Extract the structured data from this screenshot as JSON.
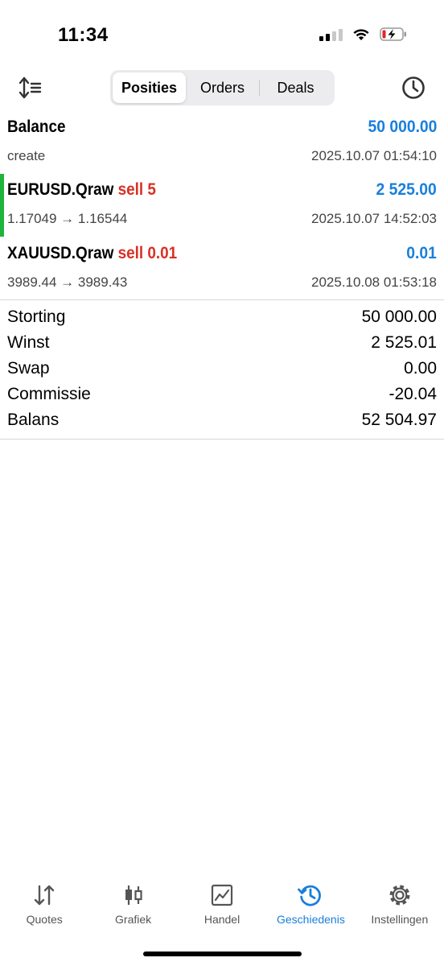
{
  "status_bar": {
    "time": "11:34"
  },
  "toolbar": {
    "segments": [
      "Posities",
      "Orders",
      "Deals"
    ],
    "active_segment": "Posities"
  },
  "deals": [
    {
      "symbol": "Balance",
      "side": "",
      "amount": "50 000.00",
      "detail": "create",
      "time": "2025.10.07 01:54:10"
    },
    {
      "symbol": "EURUSD.Qraw",
      "side": "sell 5",
      "amount": "2 525.00",
      "detail": "1.17049 → 1.16544",
      "time": "2025.10.07 14:52:03"
    },
    {
      "symbol": "XAUUSD.Qraw",
      "side": "sell 0.01",
      "amount": "0.01",
      "detail": "3989.44 → 3989.43",
      "time": "2025.10.08 01:53:18"
    }
  ],
  "summary": [
    {
      "label": "Storting",
      "value": "50 000.00"
    },
    {
      "label": "Winst",
      "value": "2 525.01"
    },
    {
      "label": "Swap",
      "value": "0.00"
    },
    {
      "label": "Commissie",
      "value": "-20.04"
    },
    {
      "label": "Balans",
      "value": "52 504.97"
    }
  ],
  "tabbar": [
    {
      "label": "Quotes",
      "icon": "quotes-arrows-icon"
    },
    {
      "label": "Grafiek",
      "icon": "candlestick-icon"
    },
    {
      "label": "Handel",
      "icon": "trade-chart-icon"
    },
    {
      "label": "Geschiedenis",
      "icon": "history-icon"
    },
    {
      "label": "Instellingen",
      "icon": "gear-icon"
    }
  ],
  "colors": {
    "accent_blue": "#1a7fdb",
    "sell_red": "#d93025",
    "selected_marker": "#1fb43b"
  }
}
